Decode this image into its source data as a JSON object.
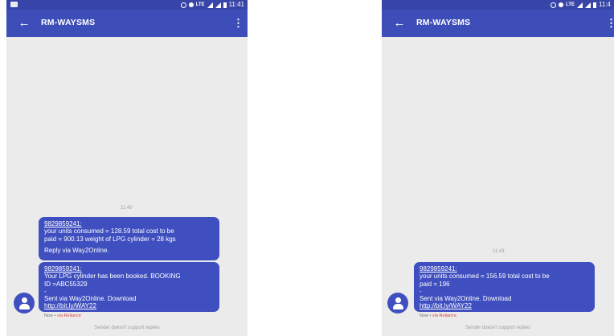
{
  "left": {
    "status_time": "11:41",
    "app_title": "RM-WAYSMS",
    "timestamp": "11:40",
    "messages": [
      {
        "sender": "9829859241:",
        "lines": [
          "your units consumed = 128.59 total cost to be",
          "paid = 900.13 weight of LPG cylinder = 28 kgs"
        ],
        "footer": "Reply via Way2Online."
      },
      {
        "sender": "9829859241:",
        "lines": [
          "Your LPG cylinder has been booked. BOOKING",
          "ID =ABC55329",
          "-",
          "Sent via Way2Online. Download"
        ],
        "link": "http://bit.ly/WAY22"
      }
    ],
    "meta_now": "Now",
    "meta_sep": " • ",
    "meta_carrier": "via Reliance",
    "footer_note": "Sender doesn't support replies"
  },
  "right": {
    "status_time": "11:4",
    "app_title": "RM-WAYSMS",
    "timestamp": "11:43",
    "message": {
      "sender": "9829859241:",
      "lines": [
        "your units consumed = 156.59 total cost to be",
        "paid = 196",
        "-",
        "Sent via Way2Online. Download"
      ],
      "link": "http://bit.ly/WAY22"
    },
    "meta_now": "Now",
    "meta_sep": " • ",
    "meta_carrier": "via Reliance",
    "footer_note": "Sender doesn't support replies"
  },
  "icons": {
    "back": "back-arrow-icon",
    "menu": "more-vertical-icon",
    "avatar": "person-icon"
  },
  "colors": {
    "status_bar": "#3845a8",
    "app_bar": "#3e4eb8",
    "bubble": "#3f4fbf",
    "background": "#ebebeb",
    "carrier": "#d84343"
  }
}
